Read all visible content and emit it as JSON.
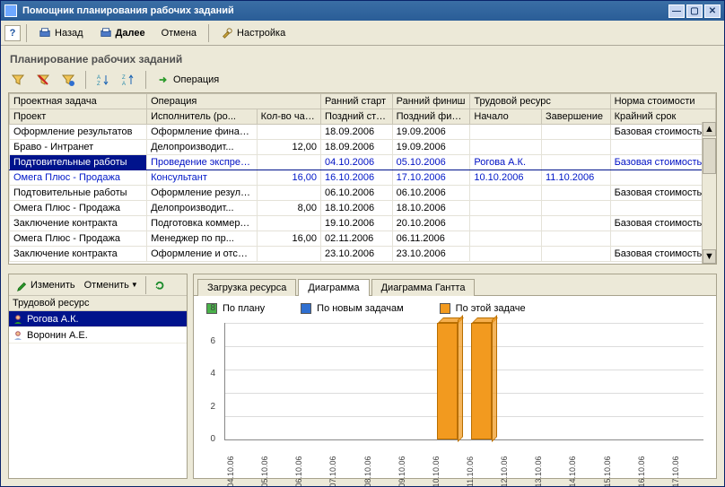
{
  "window": {
    "title": "Помощник планирования рабочих заданий"
  },
  "toolbar": {
    "back": "Назад",
    "forward": "Далее",
    "cancel": "Отмена",
    "settings": "Настройка"
  },
  "section_title": "Планирование рабочих заданий",
  "operation_btn": "Операция",
  "grid": {
    "head1": {
      "c0": "Проектная задача",
      "c1": "Операция",
      "c2": "",
      "c3": "Ранний старт",
      "c4": "Ранний финиш",
      "c5": "Трудовой ресурс",
      "c6": "",
      "c7": "Норма стоимости"
    },
    "head2": {
      "c0": "Проект",
      "c1": "Исполнитель (ро...",
      "c2": "Кол-во часов",
      "c3": "Поздний старт",
      "c4": "Поздний финиш",
      "c5": "Начало",
      "c6": "Завершение",
      "c7": "Крайний срок"
    },
    "rows": [
      {
        "c0": "Оформление результатов",
        "c1": "Оформление финального паке...",
        "c2": "",
        "c3": "18.09.2006",
        "c4": "19.09.2006",
        "c5": "",
        "c6": "",
        "c7": "Базовая стоимость"
      },
      {
        "c0": "Браво - Интранет",
        "c1": "Делопроизводит...",
        "c2": "12,00",
        "c3": "18.09.2006",
        "c4": "19.09.2006",
        "c5": "",
        "c6": "",
        "c7": ""
      },
      {
        "sel": true,
        "c0": "Подтовительные работы",
        "c1": "Проведение экспресс-обследо...",
        "c2": "",
        "c3": "04.10.2006",
        "c4": "05.10.2006",
        "c5": "Рогова А.К.",
        "c6": "",
        "c7": "Базовая стоимость"
      },
      {
        "blue": true,
        "c0": "Омега Плюс - Продажа",
        "c1": "Консультант",
        "c2": "16,00",
        "c3": "16.10.2006",
        "c4": "17.10.2006",
        "c5": "10.10.2006",
        "c6": "11.10.2006",
        "c7": ""
      },
      {
        "c0": "Подтовительные работы",
        "c1": "Оформление результатов эксп...",
        "c2": "",
        "c3": "06.10.2006",
        "c4": "06.10.2006",
        "c5": "",
        "c6": "",
        "c7": "Базовая стоимость"
      },
      {
        "c0": "Омега Плюс - Продажа",
        "c1": "Делопроизводит...",
        "c2": "8,00",
        "c3": "18.10.2006",
        "c4": "18.10.2006",
        "c5": "",
        "c6": "",
        "c7": ""
      },
      {
        "c0": "Заключение контракта",
        "c1": "Подготовка коммерческого пр...",
        "c2": "",
        "c3": "19.10.2006",
        "c4": "20.10.2006",
        "c5": "",
        "c6": "",
        "c7": "Базовая стоимость"
      },
      {
        "c0": "Омега Плюс - Продажа",
        "c1": "Менеджер по пр...",
        "c2": "16,00",
        "c3": "02.11.2006",
        "c4": "06.11.2006",
        "c5": "",
        "c6": "",
        "c7": ""
      },
      {
        "c0": "Заключение контракта",
        "c1": "Оформление и отсылка комме...",
        "c2": "",
        "c3": "23.10.2006",
        "c4": "23.10.2006",
        "c5": "",
        "c6": "",
        "c7": "Базовая стоимость"
      }
    ]
  },
  "left_panel": {
    "edit": "Изменить",
    "cancel": "Отменить",
    "dropdown": "",
    "header": "Трудовой ресурс",
    "items": [
      {
        "label": "Рогова А.К.",
        "selected": true,
        "checked": true
      },
      {
        "label": "Воронин А.Е.",
        "selected": false,
        "checked": false
      }
    ]
  },
  "tabs": {
    "t0": "Загрузка ресурса",
    "t1": "Диаграмма",
    "t2": "Диаграмма Гантта",
    "active": 1
  },
  "legend": {
    "l0": "По плану",
    "l1": "По новым задачам",
    "l2": "По этой задаче",
    "c0": "#49b24a",
    "c1": "#2f6fd0",
    "c2": "#f29a1f"
  },
  "chart_data": {
    "type": "bar",
    "title": "",
    "xlabel": "",
    "ylabel": "",
    "ylim": [
      0,
      8
    ],
    "yticks": [
      0,
      2,
      4,
      6,
      8
    ],
    "categories": [
      "04.10.06",
      "05.10.06",
      "06.10.06",
      "07.10.06",
      "08.10.06",
      "09.10.06",
      "10.10.06",
      "11.10.06",
      "12.10.06",
      "13.10.06",
      "14.10.06",
      "15.10.06",
      "16.10.06",
      "17.10.06"
    ],
    "series": [
      {
        "name": "По плану",
        "color": "#49b24a",
        "values": [
          0,
          0,
          0,
          0,
          0,
          0,
          0,
          0,
          0,
          0,
          0,
          0,
          0,
          0
        ]
      },
      {
        "name": "По новым задачам",
        "color": "#2f6fd0",
        "values": [
          0,
          0,
          0,
          0,
          0,
          0,
          0,
          0,
          0,
          0,
          0,
          0,
          0,
          0
        ]
      },
      {
        "name": "По этой задаче",
        "color": "#f29a1f",
        "values": [
          0,
          0,
          0,
          0,
          0,
          0,
          8,
          8,
          0,
          0,
          0,
          0,
          0,
          0
        ]
      }
    ]
  }
}
